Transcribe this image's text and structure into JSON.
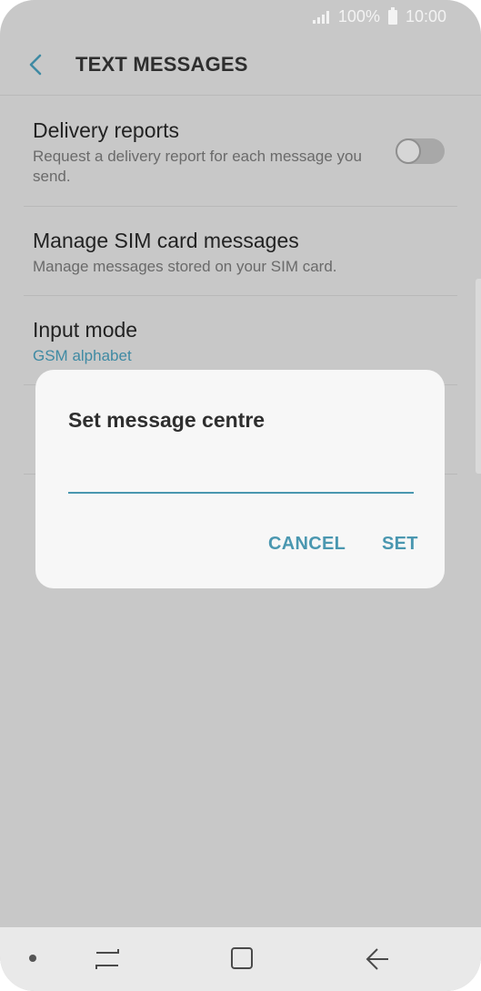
{
  "status_bar": {
    "battery_percent": "100%",
    "time": "10:00"
  },
  "header": {
    "title": "TEXT MESSAGES",
    "back_icon": "chevron-left-icon"
  },
  "settings": [
    {
      "title": "Delivery reports",
      "subtitle": "Request a delivery report for each message you send.",
      "toggle_on": false
    },
    {
      "title": "Manage SIM card messages",
      "subtitle": "Manage messages stored on your SIM card."
    },
    {
      "title": "Input mode",
      "subtitle": "GSM alphabet"
    }
  ],
  "dialog": {
    "title": "Set message centre",
    "input_value": "",
    "cancel_label": "CANCEL",
    "set_label": "SET"
  },
  "colors": {
    "accent": "#4a97b0",
    "scrim_background": "#c8c8c8",
    "dialog_background": "#f7f7f7"
  },
  "navbar": {
    "icons": [
      "dot-icon",
      "recent-apps-icon",
      "home-icon",
      "back-arrow-icon"
    ]
  }
}
